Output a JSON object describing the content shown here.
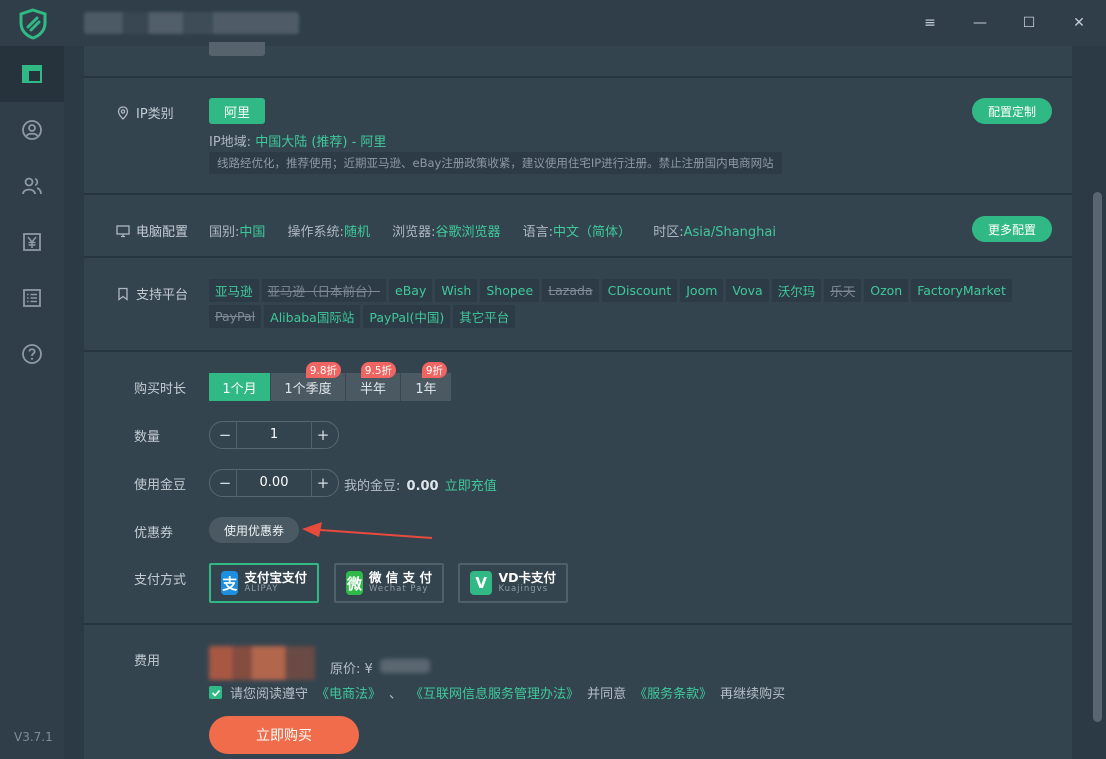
{
  "app": {
    "version": "V3.7.1",
    "accent_color": "#31b985",
    "sidebar_items": [
      {
        "name": "dashboard-icon"
      },
      {
        "name": "user-icon"
      },
      {
        "name": "team-icon"
      },
      {
        "name": "yen-icon"
      },
      {
        "name": "list-icon"
      },
      {
        "name": "help-icon"
      }
    ]
  },
  "window": {
    "menu_glyph": "≡",
    "min_glyph": "—",
    "max_glyph": "☐",
    "close_glyph": "✕"
  },
  "ip": {
    "label": "IP类别",
    "type_tag": "阿里",
    "region_key": "IP地域:",
    "region_value": "中国大陆 (推荐) - 阿里",
    "note": "线路经优化，推荐使用；近期亚马逊、eBay注册政策收紧，建议使用住宅IP进行注册。禁止注册国内电商网站",
    "custom_button": "配置定制"
  },
  "pc": {
    "label": "电脑配置",
    "fields": [
      {
        "key": "国别:",
        "value": "中国"
      },
      {
        "key": "操作系统:",
        "value": "随机"
      },
      {
        "key": "浏览器:",
        "value": "谷歌浏览器"
      },
      {
        "key": "语言:",
        "value": "中文（简体）"
      },
      {
        "key": "时区:",
        "value": "Asia/Shanghai"
      }
    ],
    "more_button": "更多配置"
  },
  "platforms": {
    "label": "支持平台",
    "items": [
      {
        "text": "亚马逊",
        "strike": false
      },
      {
        "text": "亚马逊（日本前台）",
        "strike": true
      },
      {
        "text": "eBay",
        "strike": false
      },
      {
        "text": "Wish",
        "strike": false
      },
      {
        "text": "Shopee",
        "strike": false
      },
      {
        "text": "Lazada",
        "strike": true
      },
      {
        "text": "CDiscount",
        "strike": false
      },
      {
        "text": "Joom",
        "strike": false
      },
      {
        "text": "Vova",
        "strike": false
      },
      {
        "text": "沃尔玛",
        "strike": false
      },
      {
        "text": "乐天",
        "strike": true
      },
      {
        "text": "Ozon",
        "strike": false
      },
      {
        "text": "FactoryMarket",
        "strike": false
      },
      {
        "text": "PayPal",
        "strike": true
      },
      {
        "text": "Alibaba国际站",
        "strike": false
      },
      {
        "text": "PayPal(中国)",
        "strike": false
      },
      {
        "text": "其它平台",
        "strike": false
      }
    ]
  },
  "purchase": {
    "duration_label": "购买时长",
    "durations": [
      {
        "label": "1个月",
        "badge": "",
        "active": true
      },
      {
        "label": "1个季度",
        "badge": "9.8折",
        "active": false
      },
      {
        "label": "半年",
        "badge": "9.5折",
        "active": false
      },
      {
        "label": "1年",
        "badge": "9折",
        "active": false
      }
    ],
    "quantity_label": "数量",
    "quantity": "1",
    "coins_label": "使用金豆",
    "coins_value": "0.00",
    "my_coins_label": "我的金豆:",
    "my_coins_value": "0.00",
    "recharge_link": "立即充值",
    "minus": "−",
    "plus": "+",
    "coupon_label": "优惠券",
    "coupon_button": "使用优惠券",
    "payment_label": "支付方式",
    "payments": [
      {
        "name": "支付宝支付",
        "sub": "ALIPAY",
        "icon": "支",
        "active": true
      },
      {
        "name": "微 信 支 付",
        "sub": "Wechat Pay",
        "icon": "微",
        "active": false
      },
      {
        "name": "VD卡支付",
        "sub": "Kuajingvs",
        "icon": "V",
        "active": false
      }
    ]
  },
  "fee": {
    "label": "费用",
    "original_price_label": "原价: ¥",
    "agree_prefix": "请您阅读遵守",
    "law1": "《电商法》",
    "sep": "、",
    "law2": "《互联网信息服务管理办法》",
    "agree_mid": "并同意",
    "law3": "《服务条款》",
    "agree_suffix": "再继续购买",
    "buy_button": "立即购买"
  }
}
